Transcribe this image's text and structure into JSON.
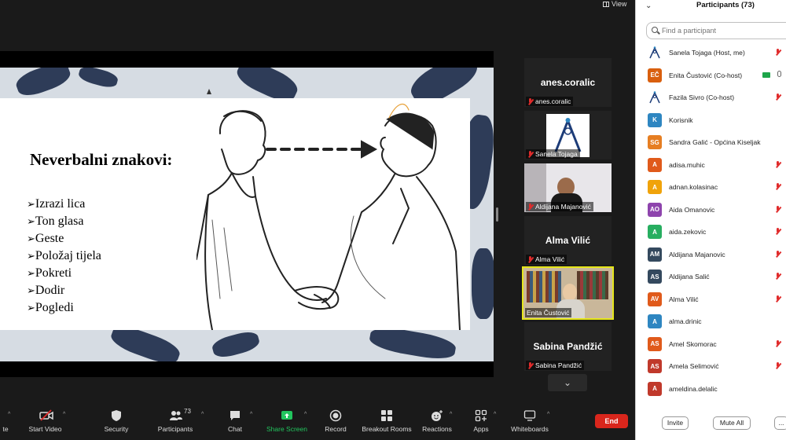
{
  "view_label": "View",
  "slide": {
    "title": "Neverbalni znakovi:",
    "items": [
      "Izrazi lica",
      "Ton glasa",
      "Geste",
      "Položaj tijela",
      "Pokreti",
      "Dodir",
      "Pogledi"
    ]
  },
  "video_tiles": [
    {
      "name_text": "anes.coralic",
      "label": "anes.coralic",
      "type": "name"
    },
    {
      "name_text": "",
      "label": "Sanela Tojaga",
      "type": "logo"
    },
    {
      "name_text": "",
      "label": "Aldijana Majanović",
      "type": "video"
    },
    {
      "name_text": "Alma Vilić",
      "label": "Alma Vilić",
      "type": "name"
    },
    {
      "name_text": "",
      "label": "Enita Čustović",
      "type": "video-active"
    },
    {
      "name_text": "Sabina Pandžić",
      "label": "Sabina Pandžić",
      "type": "name"
    }
  ],
  "panel": {
    "title": "Participants (73)",
    "search_placeholder": "Find a participant",
    "participants": [
      {
        "initials": "",
        "name": "Sanela Tojaga (Host, me)",
        "color": "",
        "logo": true,
        "muted": true
      },
      {
        "initials": "EČ",
        "name": "Enita Čustović (Co-host)",
        "color": "#d95f0e",
        "logo": false,
        "muted": false,
        "camera": true
      },
      {
        "initials": "",
        "name": "Fazila Sivro (Co-host)",
        "color": "",
        "logo": true,
        "muted": true
      },
      {
        "initials": "K",
        "name": "Korisnik",
        "color": "#2e86c1",
        "logo": false,
        "muted": false
      },
      {
        "initials": "SG",
        "name": "Sandra Galić - Općina Kiseljak",
        "color": "#e67e22",
        "logo": false,
        "muted": false
      },
      {
        "initials": "A",
        "name": "adisa.muhic",
        "color": "#e05a1b",
        "logo": false,
        "muted": true
      },
      {
        "initials": "A",
        "name": "adnan.kolasinac",
        "color": "#f0a30a",
        "logo": false,
        "muted": true
      },
      {
        "initials": "AO",
        "name": "Aida Omanovic",
        "color": "#8e44ad",
        "logo": false,
        "muted": true
      },
      {
        "initials": "A",
        "name": "aida.zekovic",
        "color": "#27ae60",
        "logo": false,
        "muted": true
      },
      {
        "initials": "AM",
        "name": "Aldijana Majanovic",
        "color": "#34495e",
        "logo": false,
        "muted": true
      },
      {
        "initials": "AS",
        "name": "Aldijana Salić",
        "color": "#34495e",
        "logo": false,
        "muted": true
      },
      {
        "initials": "AV",
        "name": "Alma Vilić",
        "color": "#e05a1b",
        "logo": false,
        "muted": true
      },
      {
        "initials": "A",
        "name": "alma.drinic",
        "color": "#2e86c1",
        "logo": false,
        "muted": false
      },
      {
        "initials": "AS",
        "name": "Amel Skomorac",
        "color": "#e05a1b",
        "logo": false,
        "muted": true
      },
      {
        "initials": "AS",
        "name": "Amela Selimović",
        "color": "#c0392b",
        "logo": false,
        "muted": true
      },
      {
        "initials": "A",
        "name": "ameldina.delalic",
        "color": "#c0392b",
        "logo": false,
        "muted": false
      }
    ],
    "invite_label": "Invite",
    "mute_all_label": "Mute All",
    "more_label": "..."
  },
  "toolbar": {
    "mute_label": "te",
    "start_video_label": "Start Video",
    "security_label": "Security",
    "participants_label": "Participants",
    "participants_count": "73",
    "chat_label": "Chat",
    "share_screen_label": "Share Screen",
    "record_label": "Record",
    "breakout_label": "Breakout Rooms",
    "reactions_label": "Reactions",
    "apps_label": "Apps",
    "whiteboards_label": "Whiteboards",
    "end_label": "End",
    "share_color": "#22c55e",
    "end_color": "#d9261c"
  }
}
